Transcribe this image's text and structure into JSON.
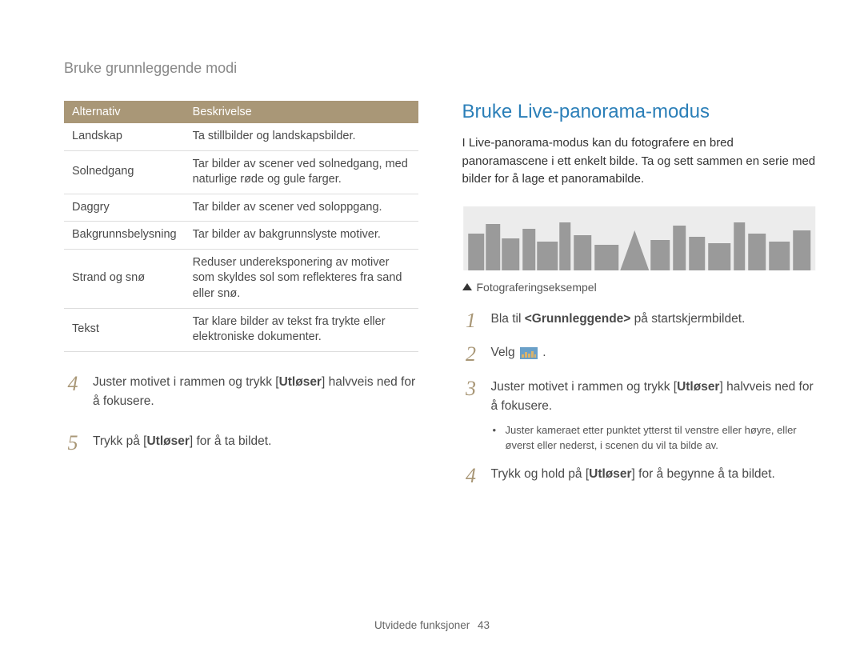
{
  "header": {
    "breadcrumb": "Bruke grunnleggende modi"
  },
  "table": {
    "headers": [
      "Alternativ",
      "Beskrivelse"
    ],
    "rows": [
      {
        "opt": "Landskap",
        "desc": "Ta stillbilder og landskapsbilder."
      },
      {
        "opt": "Solnedgang",
        "desc": "Tar bilder av scener ved solnedgang, med naturlige røde og gule farger."
      },
      {
        "opt": "Daggry",
        "desc": "Tar bilder av scener ved soloppgang."
      },
      {
        "opt": "Bakgrunnsbelysning",
        "desc": "Tar bilder av bakgrunnslyste motiver."
      },
      {
        "opt": "Strand og snø",
        "desc": "Reduser undereksponering av motiver som skyldes sol som reflekteres fra sand eller snø."
      },
      {
        "opt": "Tekst",
        "desc": "Tar klare bilder av tekst fra trykte eller elektroniske dokumenter."
      }
    ]
  },
  "left_steps": [
    {
      "num": "4",
      "pre": "Juster motivet i rammen og trykk [",
      "bold": "Utløser",
      "post": "] halvveis ned for å fokusere."
    },
    {
      "num": "5",
      "pre": "Trykk på [",
      "bold": "Utløser",
      "post": "] for å ta bildet."
    }
  ],
  "right": {
    "title": "Bruke Live-panorama-modus",
    "intro": "I Live-panorama-modus kan du fotografere en bred panoramascene i ett enkelt bilde. Ta og sett sammen en serie med bilder for å lage et panoramabilde.",
    "caption": "Fotograferingseksempel",
    "steps": {
      "s1_pre": "Bla til ",
      "s1_bold": "<Grunnleggende>",
      "s1_post": " på startskjermbildet.",
      "s2_pre": "Velg ",
      "s2_post": ".",
      "s3_pre": "Juster motivet i rammen og trykk [",
      "s3_bold": "Utløser",
      "s3_post": "] halvveis ned for å fokusere.",
      "s3_sub": "Juster kameraet etter punktet ytterst til venstre eller høyre, eller øverst eller nederst, i scenen du vil ta bilde av.",
      "s4_pre": "Trykk og hold på [",
      "s4_bold": "Utløser",
      "s4_post": "] for å begynne å ta bildet."
    }
  },
  "footer": {
    "section": "Utvidede funksjoner",
    "page": "43"
  }
}
